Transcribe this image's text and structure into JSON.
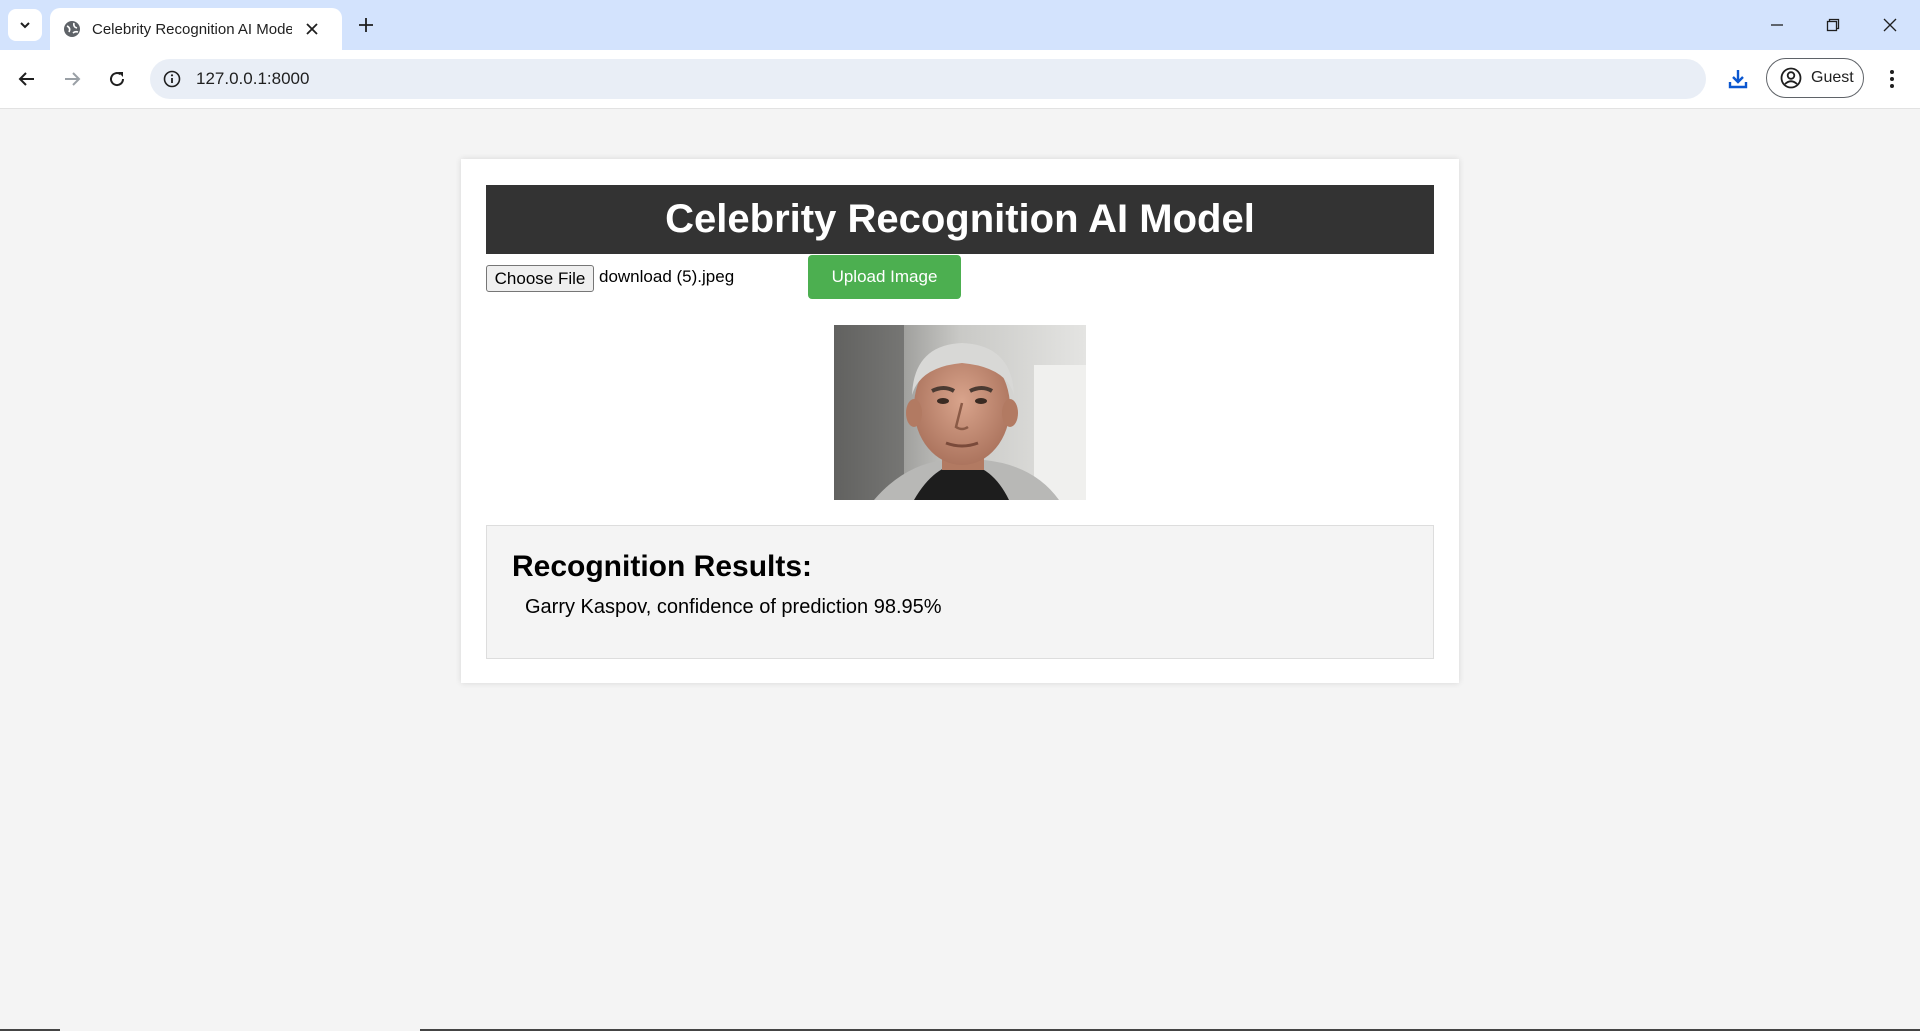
{
  "browser": {
    "tab_title": "Celebrity Recognition AI Model",
    "url": "127.0.0.1:8000",
    "profile_label": "Guest"
  },
  "page": {
    "heading": "Celebrity Recognition AI Model",
    "choose_file_label": "Choose File",
    "selected_file": "download (5).jpeg",
    "upload_button_label": "Upload Image",
    "results_heading": "Recognition Results:",
    "result_text": "Garry Kaspov, confidence of prediction 98.95%"
  },
  "colors": {
    "header_bg": "#333333",
    "upload_button_bg": "#4caf50",
    "tab_strip_bg": "#d3e3fd",
    "page_bg": "#f4f4f4"
  },
  "icons": {
    "tab_list": "chevron-down-icon",
    "favicon": "globe-icon",
    "tab_close": "close-icon",
    "new_tab": "plus-icon",
    "back": "arrow-left-icon",
    "forward": "arrow-right-icon",
    "reload": "reload-icon",
    "site_info": "info-icon",
    "download": "download-icon",
    "profile": "account-icon",
    "menu": "more-vertical-icon"
  }
}
